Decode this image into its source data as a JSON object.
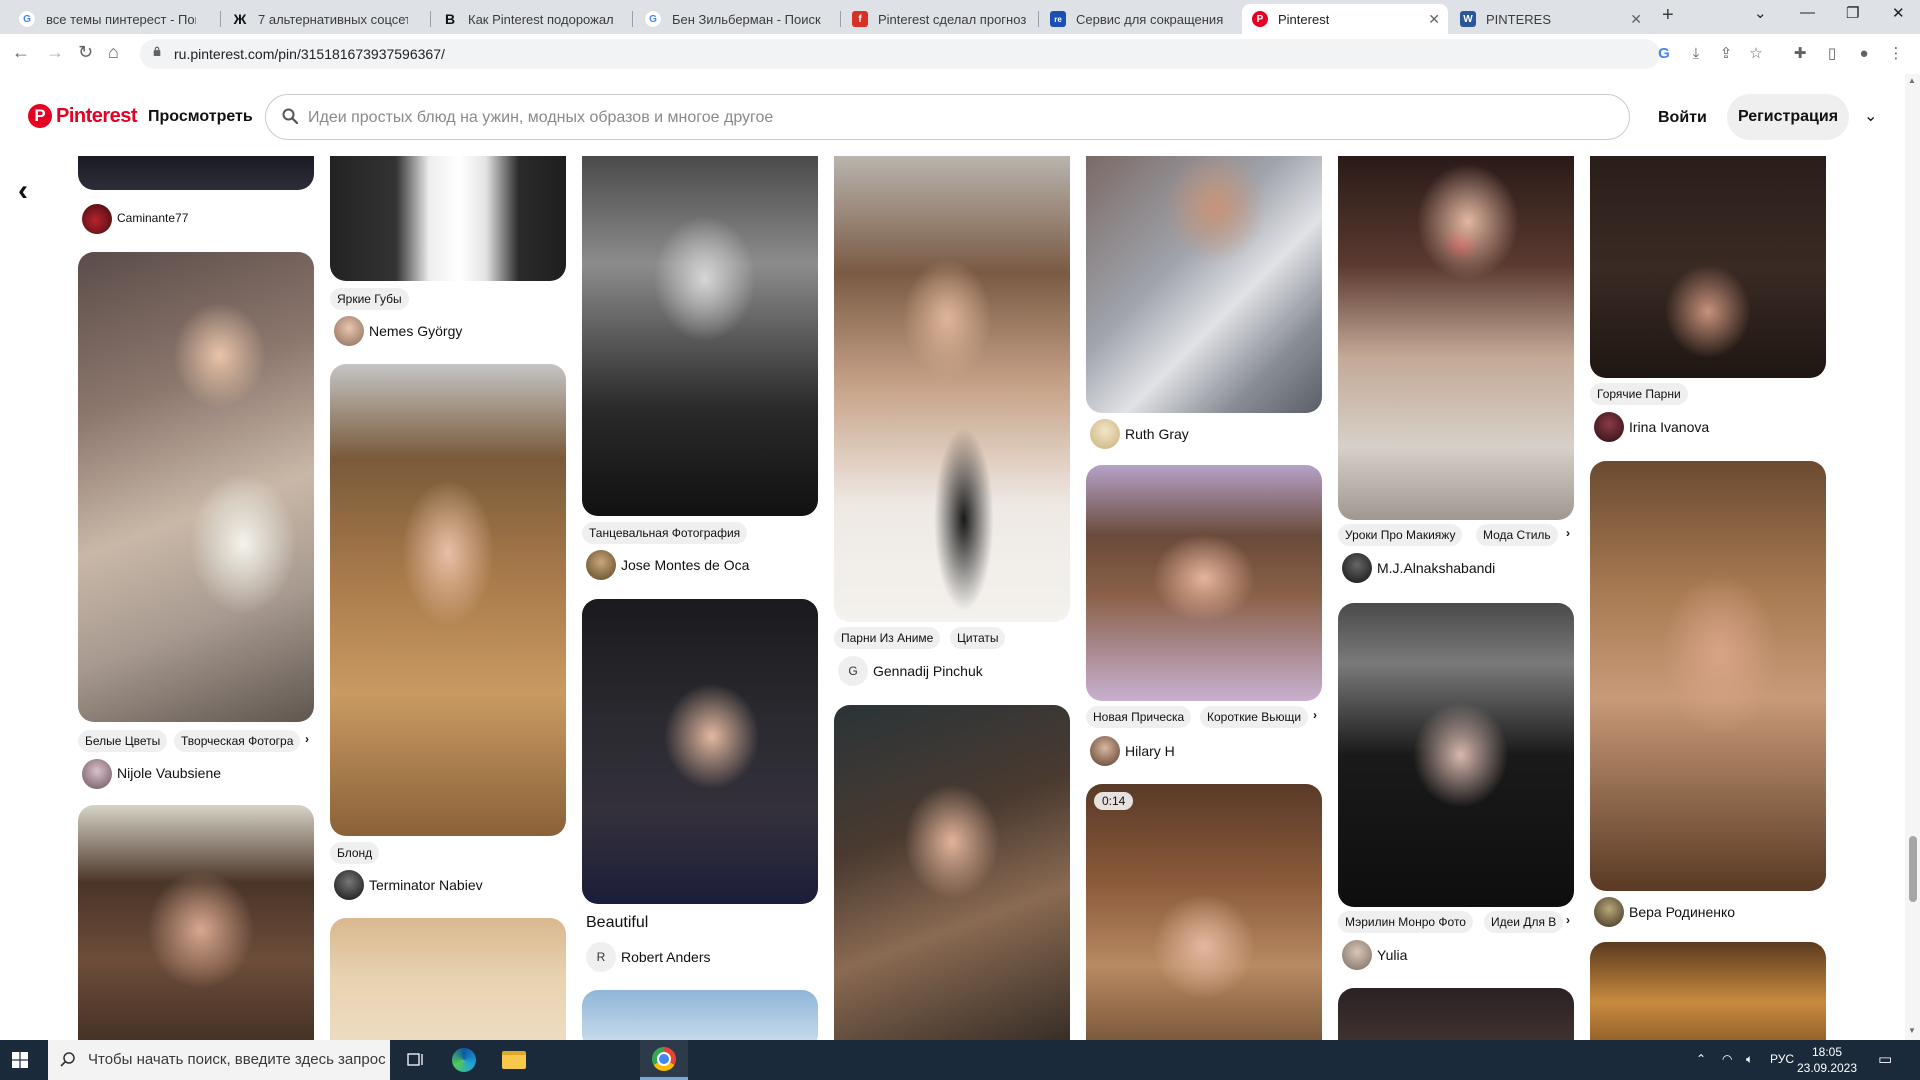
{
  "browser": {
    "tabs": [
      {
        "title": "все темы пинтерест - Пои",
        "favicon": "google-icon",
        "color": "#4285f4",
        "glyph": "G"
      },
      {
        "title": "7 альтернативных соцсет",
        "favicon": "typewriter-icon",
        "color": "#333333",
        "glyph": "Ж"
      },
      {
        "title": "Как Pinterest подорожал",
        "favicon": "vc-icon",
        "color": "#111111",
        "glyph": "B"
      },
      {
        "title": "Бен Зильберман - Поиск",
        "favicon": "google-icon",
        "color": "#4285f4",
        "glyph": "G"
      },
      {
        "title": "Pinterest сделал прогноз",
        "favicon": "flag-icon",
        "color": "#d93025",
        "glyph": "f"
      },
      {
        "title": "Сервис для сокращения",
        "favicon": "re-icon",
        "color": "#1a4fb4",
        "glyph": "re"
      },
      {
        "title": "Pinterest",
        "favicon": "pinterest-icon",
        "color": "#e60023",
        "glyph": "P",
        "active": true
      },
      {
        "title": "PINTERES",
        "favicon": "word-icon",
        "color": "#2b579a",
        "glyph": "W"
      }
    ],
    "new_tab_label": "+",
    "url": "ru.pinterest.com/pin/315181673937596367/"
  },
  "header": {
    "logo_letter": "P",
    "brand": "Pinterest",
    "explore": "Просмотреть",
    "search_placeholder": "Идеи простых блюд на ужин, модных образов и многое другое",
    "login": "Войти",
    "signup": "Регистрация"
  },
  "pins": {
    "c1_1": {
      "author": "Caminante77"
    },
    "c1_2": {
      "chips": [
        "Белые Цветы",
        "Творческая Фотогра"
      ],
      "author": "Nijole Vaubsiene"
    },
    "c2_1": {
      "chips": [
        "Яркие Губы"
      ],
      "author": "Nemes György"
    },
    "c2_2": {
      "chips": [
        "Блонд"
      ],
      "author": "Terminator Nabiev"
    },
    "c3_1": {
      "chips": [
        "Танцевальная Фотография"
      ],
      "author": "Jose Montes de Oca"
    },
    "c3_2": {
      "title": "Beautiful",
      "author_initial": "R",
      "author": "Robert Anders"
    },
    "c4_1": {
      "chips": [
        "Парни Из Аниме",
        "Цитаты"
      ],
      "author_initial": "G",
      "author": "Gennadij Pinchuk"
    },
    "c5_1": {
      "author": "Ruth Gray"
    },
    "c5_2": {
      "chips": [
        "Новая Прическа",
        "Короткие Вьющи"
      ],
      "author": "Hilary H"
    },
    "c5_3": {
      "duration": "0:14"
    },
    "c6_1": {
      "chips": [
        "Уроки Про Макияжу",
        "Мода Стиль"
      ],
      "author": "M.J.Alnakshabandi"
    },
    "c6_2": {
      "chips": [
        "Мэрилин Монро Фото",
        "Идеи Для В"
      ],
      "author": "Yulia"
    },
    "c7_1": {
      "chips": [
        "Горячие Парни"
      ],
      "author": "Irina Ivanova"
    },
    "c7_2": {
      "author": "Вера Родиненко"
    }
  },
  "taskbar": {
    "search_placeholder": "Чтобы начать поиск, введите здесь запрос",
    "lang": "РУС",
    "time": "18:05",
    "date": "23.09.2023"
  }
}
